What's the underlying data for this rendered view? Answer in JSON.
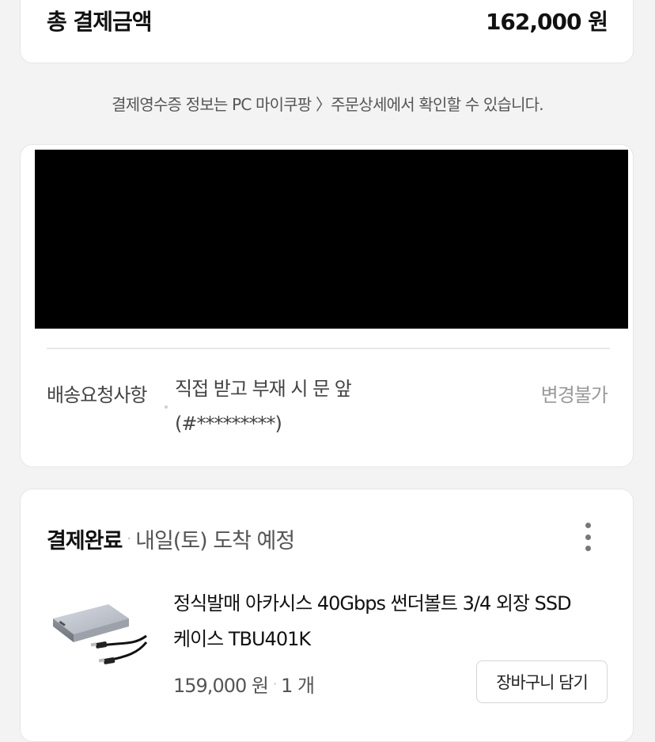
{
  "total": {
    "label": "총 결제금액",
    "value": "162,000 원"
  },
  "receipt_note": "결제영수증 정보는 PC 마이쿠팡 〉주문상세에서 확인할 수 있습니다.",
  "delivery": {
    "request_label": "배송요청사항",
    "request_value_line1": "직접 받고 부재 시 문 앞",
    "request_value_line2": "(#*********)",
    "change_label": "변경불가"
  },
  "order": {
    "status": "결제완료",
    "separator": "·",
    "arrival": "내일(토) 도착 예정",
    "product": {
      "title_line1": "정식발매 아카시스 40Gbps 썬더볼트 3/4 외장 SSD",
      "title_line2": "케이스 TBU401K",
      "price": "159,000 원",
      "quantity": "1 개",
      "image_icon": "ssd-enclosure-with-cables"
    },
    "cart_button_label": "장바구니 담기",
    "more_icon": "kebab-vertical-icon"
  }
}
